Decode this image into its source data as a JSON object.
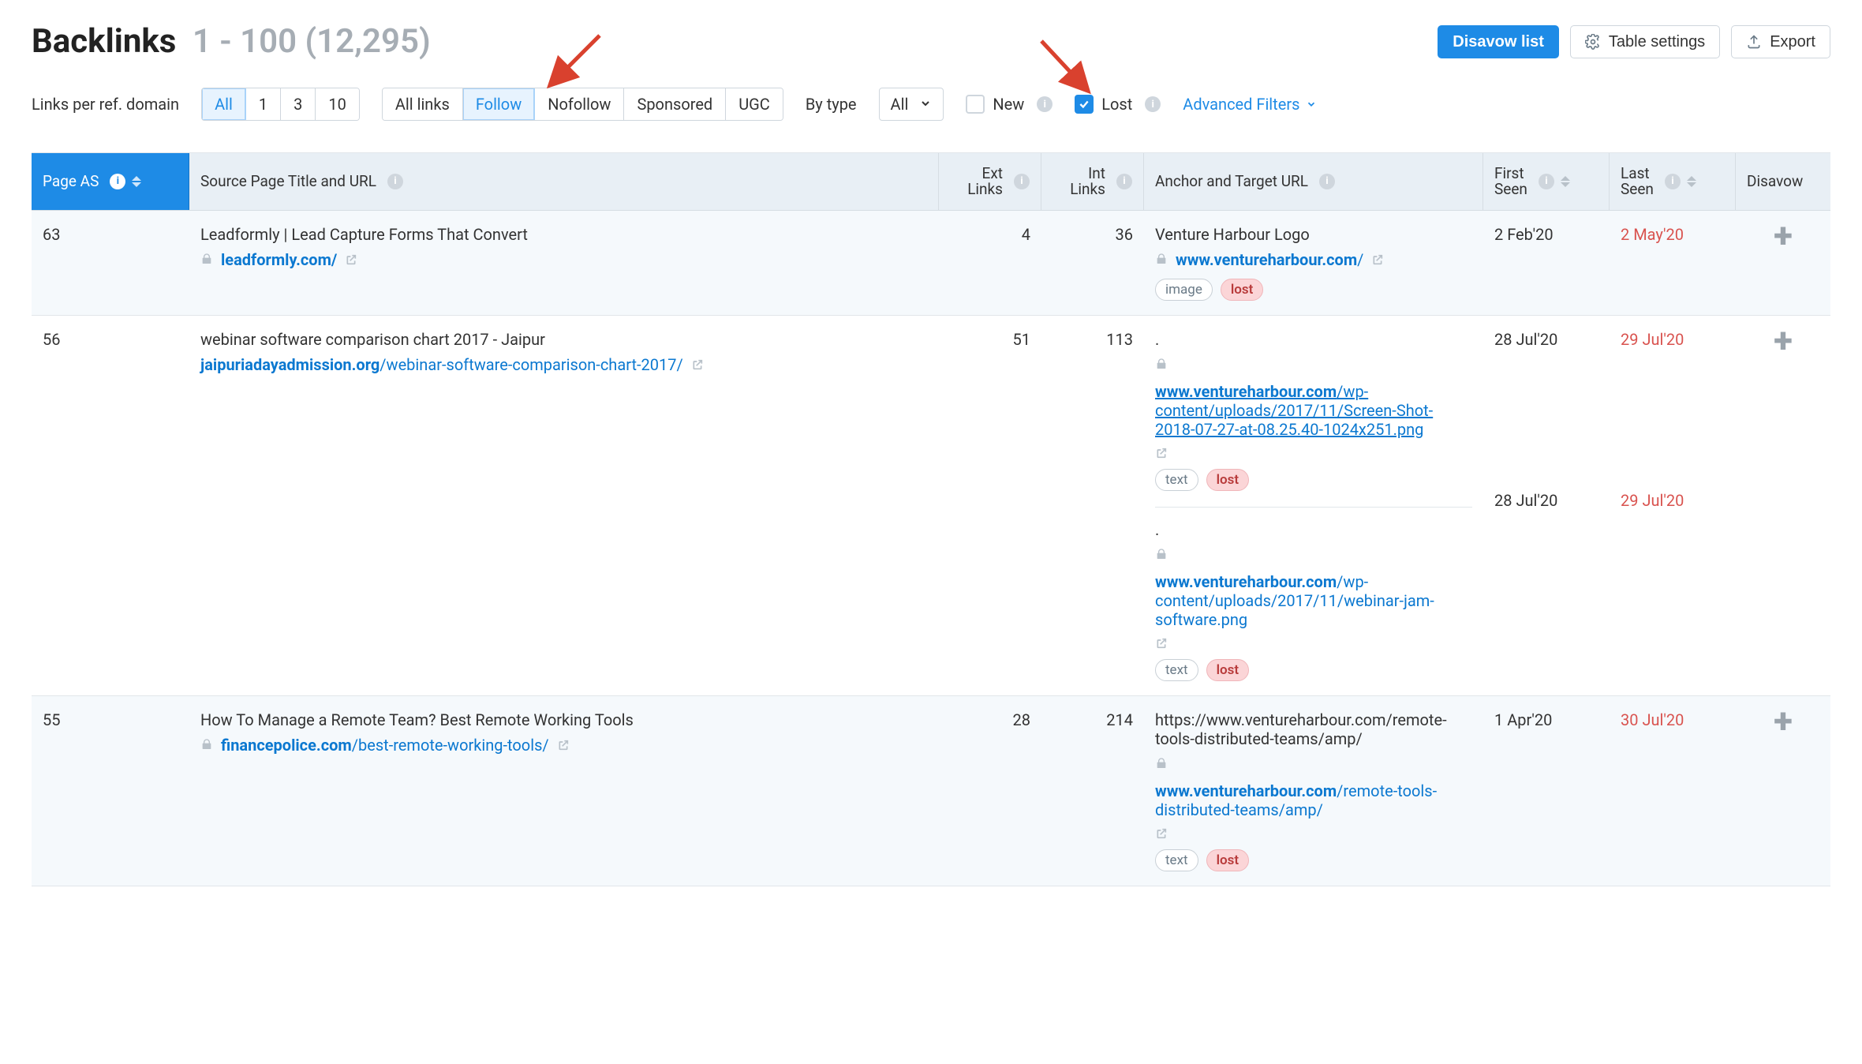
{
  "header": {
    "title": "Backlinks",
    "range": "1 - 100 (12,295)",
    "disavow_list": "Disavow list",
    "table_settings": "Table settings",
    "export": "Export"
  },
  "toolbar": {
    "links_per_domain_label": "Links per ref. domain",
    "per_domain_options": [
      "All",
      "1",
      "3",
      "10"
    ],
    "per_domain_active_index": 0,
    "link_type_options": [
      "All links",
      "Follow",
      "Nofollow",
      "Sponsored",
      "UGC"
    ],
    "link_type_active_index": 1,
    "by_type_label": "By type",
    "by_type_selected": "All",
    "new_label": "New",
    "new_checked": false,
    "lost_label": "Lost",
    "lost_checked": true,
    "advanced_filters": "Advanced Filters"
  },
  "columns": {
    "page_as": "Page AS",
    "source": "Source Page Title and URL",
    "ext_links1": "Ext",
    "ext_links2": "Links",
    "int_links1": "Int",
    "int_links2": "Links",
    "anchor": "Anchor and Target URL",
    "first_seen1": "First",
    "first_seen2": "Seen",
    "last_seen1": "Last",
    "last_seen2": "Seen",
    "disavow": "Disavow"
  },
  "rows": [
    {
      "as": "63",
      "src_title": "Leadformly | Lead Capture Forms That Convert",
      "src_lock": true,
      "src_domain": "leadformly.com",
      "src_path": "/",
      "src_bold_path": true,
      "src_underline": false,
      "ext_links": "4",
      "int_links": "36",
      "anchors": [
        {
          "text": "Venture Harbour Logo",
          "lock": true,
          "domain": "www.ventureharbour.com",
          "path": "/",
          "underline": false,
          "chips": [
            "image",
            "lost"
          ],
          "first_seen": "2 Feb'20",
          "last_seen": "2 May'20"
        }
      ]
    },
    {
      "as": "56",
      "src_title": "webinar software comparison chart 2017 - Jaipur",
      "src_lock": false,
      "src_domain": "jaipuriadayadmission.org",
      "src_path": "/webinar-software-comparison-chart-2017/",
      "src_bold_path": false,
      "src_underline": false,
      "ext_links": "51",
      "int_links": "113",
      "anchors": [
        {
          "text": ".",
          "lock": true,
          "domain": "www.ventureharbour.com",
          "path": "/wp-content/uploads/2017/11/Screen-Shot-2018-07-27-at-08.25.40-1024x251.png",
          "underline": true,
          "chips": [
            "text",
            "lost"
          ],
          "first_seen": "28 Jul'20",
          "last_seen": "29 Jul'20"
        },
        {
          "text": ".",
          "lock": true,
          "domain": "www.ventureharbour.com",
          "path": "/wp-content/uploads/2017/11/webinar-jam-software.png",
          "underline": false,
          "chips": [
            "text",
            "lost"
          ],
          "first_seen": "28 Jul'20",
          "last_seen": "29 Jul'20"
        }
      ]
    },
    {
      "as": "55",
      "src_title": "How To Manage a Remote Team? Best Remote Working Tools",
      "src_lock": true,
      "src_domain": "financepolice.com",
      "src_path": "/best-remote-working-tools/",
      "src_bold_path": false,
      "src_underline": false,
      "ext_links": "28",
      "int_links": "214",
      "anchors": [
        {
          "text": "https://www.ventureharbour.com/remote-tools-distributed-teams/amp/",
          "lock": true,
          "domain": "www.ventureharbour.com",
          "path": "/remote-tools-distributed-teams/amp/",
          "underline": false,
          "chips": [
            "text",
            "lost"
          ],
          "first_seen": "1 Apr'20",
          "last_seen": "30 Jul'20"
        }
      ]
    }
  ]
}
